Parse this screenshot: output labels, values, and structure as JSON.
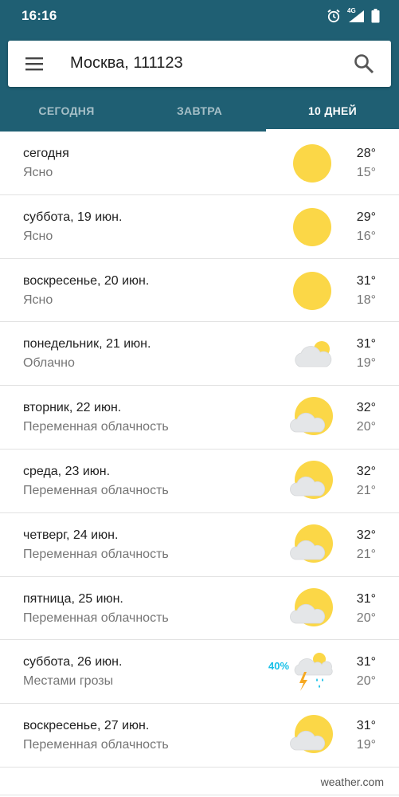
{
  "status_bar": {
    "time": "16:16",
    "icons": [
      "alarm-icon",
      "signal-4g-icon",
      "battery-icon"
    ],
    "network": "4G"
  },
  "search": {
    "location": "Москва, 111123"
  },
  "tabs": [
    {
      "label": "СЕГОДНЯ",
      "active": false
    },
    {
      "label": "ЗАВТРА",
      "active": false
    },
    {
      "label": "10 ДНЕЙ",
      "active": true
    }
  ],
  "forecast": [
    {
      "day": "сегодня",
      "condition": "Ясно",
      "high": "28°",
      "low": "15°",
      "icon": "sun"
    },
    {
      "day": "суббота, 19 июн.",
      "condition": "Ясно",
      "high": "29°",
      "low": "16°",
      "icon": "sun"
    },
    {
      "day": "воскресенье, 20 июн.",
      "condition": "Ясно",
      "high": "31°",
      "low": "18°",
      "icon": "sun"
    },
    {
      "day": "понедельник, 21 июн.",
      "condition": "Облачно",
      "high": "31°",
      "low": "19°",
      "icon": "cloudy"
    },
    {
      "day": "вторник, 22 июн.",
      "condition": "Переменная облачность",
      "high": "32°",
      "low": "20°",
      "icon": "partly-cloudy"
    },
    {
      "day": "среда, 23 июн.",
      "condition": "Переменная облачность",
      "high": "32°",
      "low": "21°",
      "icon": "partly-cloudy"
    },
    {
      "day": "четверг, 24 июн.",
      "condition": "Переменная облачность",
      "high": "32°",
      "low": "21°",
      "icon": "partly-cloudy"
    },
    {
      "day": "пятница, 25 июн.",
      "condition": "Переменная облачность",
      "high": "31°",
      "low": "20°",
      "icon": "partly-cloudy"
    },
    {
      "day": "суббота, 26 июн.",
      "condition": "Местами грозы",
      "high": "31°",
      "low": "20°",
      "icon": "thunderstorm",
      "precip": "40%"
    },
    {
      "day": "воскресенье, 27 июн.",
      "condition": "Переменная облачность",
      "high": "31°",
      "low": "19°",
      "icon": "partly-cloudy"
    }
  ],
  "attribution": "weather.com",
  "colors": {
    "header": "#1f5f73",
    "sun": "#fbd747",
    "cloud": "#e4e6e8",
    "precip": "#18c0e8"
  }
}
